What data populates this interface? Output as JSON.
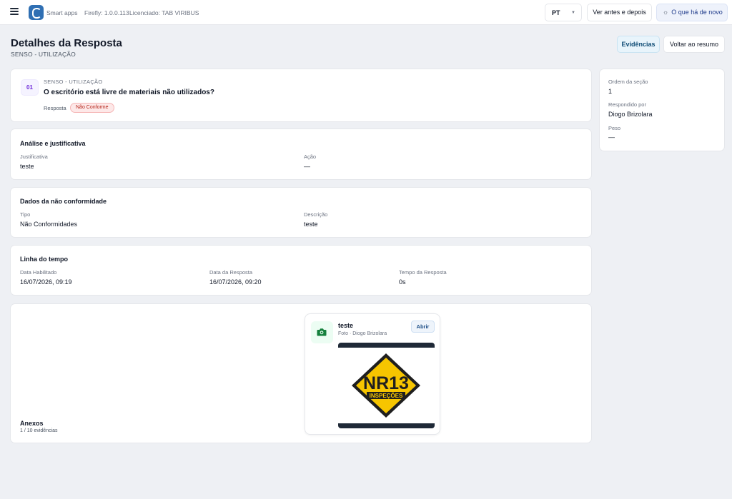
{
  "topbar": {
    "brand": "Smart apps",
    "version": "Firefly: 1.0.0.113",
    "license": "Licenciado: TAB VIRIBUS",
    "language": "PT",
    "before_after_label": "Ver antes e depois",
    "whats_new_label": "O que há de novo"
  },
  "header": {
    "title": "Detalhes da Resposta",
    "subtitle": "SENSO - UTILIZAÇÃO",
    "evidence_button": "Evidências",
    "back_button": "Voltar ao resumo"
  },
  "question": {
    "number": "01",
    "section": "SENSO - UTILIZAÇÃO",
    "text": "O escritório está livre de materiais não utilizados?",
    "response_label": "Resposta",
    "response_value": "Não Conforme",
    "status_color": "#b42318"
  },
  "side_info": {
    "section_order_label": "Ordem da seção",
    "section_order_value": "1",
    "answered_by_label": "Respondido por",
    "answered_by_value": "Diogo Brizolara",
    "weight_label": "Peso",
    "weight_value": "—"
  },
  "analysis": {
    "title": "Análise e justificativa",
    "justification_label": "Justificativa",
    "justification_value": "teste",
    "action_label": "Ação",
    "action_value": "—"
  },
  "nonconformity": {
    "title": "Dados da não conformidade",
    "type_label": "Tipo",
    "type_value": "Não Conformidades",
    "description_label": "Descrição",
    "description_value": "teste"
  },
  "timeline": {
    "title": "Linha do tempo",
    "enabled_label": "Data Habilitado",
    "enabled_value": "16/07/2026, 09:19",
    "response_date_label": "Data da Resposta",
    "response_date_value": "16/07/2026, 09:20",
    "response_time_label": "Tempo da Resposta",
    "response_time_value": "0s"
  },
  "attachments": {
    "title": "Anexos",
    "count": "1 / 10 evidências",
    "evidence": {
      "title": "teste",
      "meta": "Foto · Diogo Brizolara",
      "open_button": "Abrir",
      "image_text_main": "NR13",
      "image_text_sub": "INSPEÇÕES"
    }
  },
  "colors": {
    "accent": "#1e4f87",
    "badge_bg": "#fde8e8",
    "sign_yellow": "#f6c500"
  }
}
